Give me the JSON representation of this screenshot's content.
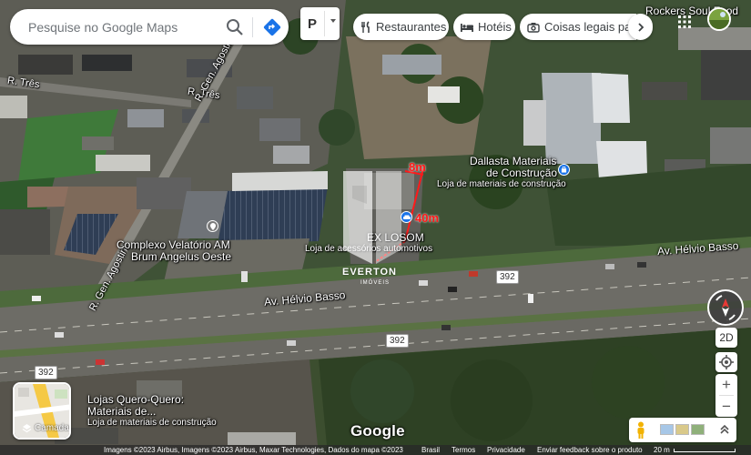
{
  "search": {
    "placeholder": "Pesquise no Google Maps"
  },
  "filters": {
    "layer_glyph": "P",
    "chips": [
      {
        "label": "Restaurantes",
        "icon": "restaurant-icon"
      },
      {
        "label": "Hotéis",
        "icon": "hotel-icon"
      },
      {
        "label": "Coisas legais para"
      }
    ]
  },
  "top_right_label": "Rockers Soul Food",
  "streets": {
    "r_tres_1": "R. Três",
    "r_tres_2": "R. Três",
    "gen_agostini_1": "R. Gen. Agostini",
    "gen_agostini_2": "R. Gen. Agostini",
    "helvio_basso_1": "Av. Hélvio Basso",
    "helvio_basso_2": "Av. Hélvio Basso"
  },
  "route_shields": [
    "392",
    "392",
    "392"
  ],
  "pois": [
    {
      "id": "dallasta",
      "name_1": "Dallasta Materiais",
      "name_2": "de Construção",
      "sub": "Loja de materiais de construção"
    },
    {
      "id": "velatorio",
      "name_1": "Complexo Velatório AM",
      "name_2": "Brum Angelus Oeste"
    },
    {
      "id": "exlosom",
      "name_1": "EX LOSOM",
      "sub": "Loja de acessórios automotivos"
    },
    {
      "id": "queroquero",
      "name_1": "Lojas Quero-Quero:",
      "name_2": "Materiais de...",
      "sub": "Loja de materiais de construção"
    }
  ],
  "measurements": {
    "short_side": "8m",
    "long_side": "40m"
  },
  "watermark": {
    "name": "EVERTON",
    "sub": "IMÓVEIS"
  },
  "controls": {
    "layers_label": "Camadas",
    "mode_2d": "2D",
    "zoom_in": "+",
    "zoom_out": "−"
  },
  "google_logo": "Google",
  "footer": {
    "attribution": "Imagens ©2023 Airbus, Imagens ©2023 Airbus, Maxar Technologies, Dados do mapa ©2023",
    "country": "Brasil",
    "terms": "Termos",
    "privacy": "Privacidade",
    "feedback": "Enviar feedback sobre o produto",
    "scale": "20 m"
  },
  "colors": {
    "accent_blue": "#1a73e8",
    "measure_red": "#ff1a1a"
  }
}
